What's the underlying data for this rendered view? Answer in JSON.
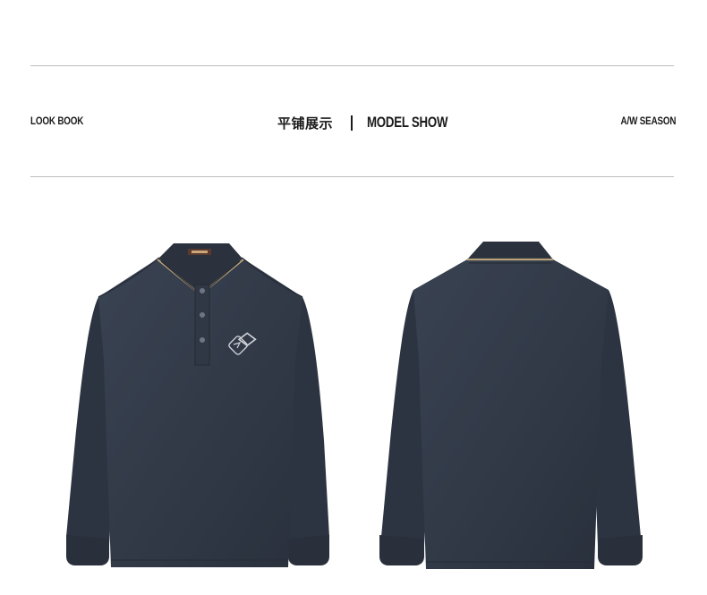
{
  "header": {
    "left_label": "LOOK BOOK",
    "center_cn": "平铺展示",
    "center_en": "MODEL SHOW",
    "right_label": "A/W SEASON"
  },
  "products": [
    {
      "name": "polo-front",
      "view": "front",
      "color": "#323a48"
    },
    {
      "name": "polo-back",
      "view": "back",
      "color": "#323a48"
    }
  ],
  "colors": {
    "fabric": "#323a48",
    "fabric_dark": "#262c37",
    "trim": "#b9a27a",
    "rule": "#bdbdbd"
  }
}
